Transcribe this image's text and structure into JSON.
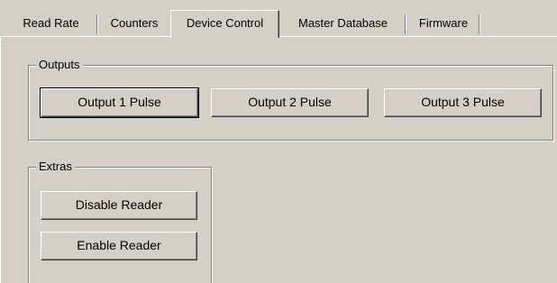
{
  "tabs": [
    {
      "label": "Read Rate",
      "active": false
    },
    {
      "label": "Counters",
      "active": false
    },
    {
      "label": "Device Control",
      "active": true
    },
    {
      "label": "Master Database",
      "active": false
    },
    {
      "label": "Firmware",
      "active": false
    }
  ],
  "outputs": {
    "label": "Outputs",
    "buttons": [
      "Output 1 Pulse",
      "Output 2 Pulse",
      "Output 3 Pulse"
    ]
  },
  "extras": {
    "label": "Extras",
    "buttons": [
      "Disable Reader",
      "Enable Reader"
    ]
  }
}
